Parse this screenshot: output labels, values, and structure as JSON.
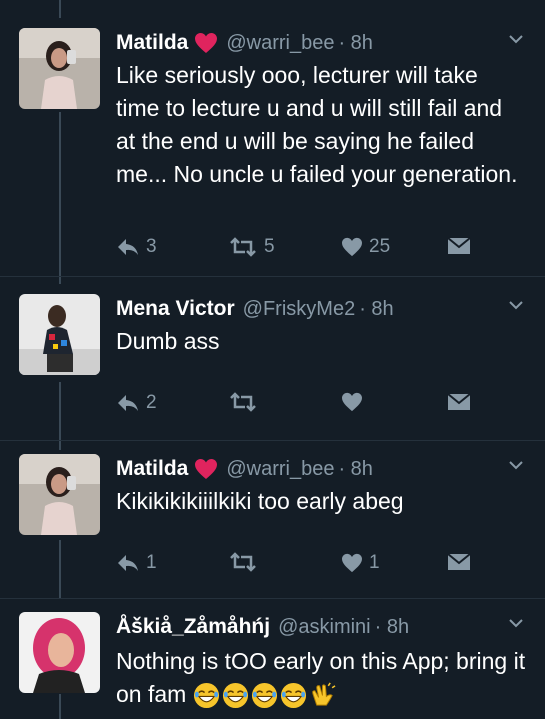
{
  "colors": {
    "background": "#141d26",
    "text": "#ffffff",
    "muted": "#8899a6",
    "icon": "#8899a6",
    "heart_badge": "#e0245e"
  },
  "tweets": [
    {
      "name": "Matilda",
      "handle": "@warri_bee",
      "time": "· 8h",
      "has_heart_badge": true,
      "text": "Like seriously ooo,  lecturer will take time to lecture u and u will still fail and at the end u will be saying he failed me... No uncle u failed your generation.",
      "replies": "3",
      "retweets": "5",
      "likes": "25"
    },
    {
      "name": "Mena Victor",
      "handle": "@FriskyMe2",
      "time": "· 8h",
      "has_heart_badge": false,
      "text": "Dumb ass",
      "replies": "2",
      "retweets": "",
      "likes": ""
    },
    {
      "name": "Matilda",
      "handle": "@warri_bee",
      "time": "· 8h",
      "has_heart_badge": true,
      "text": "Kikikikikiiilkiki too early abeg",
      "replies": "1",
      "retweets": "",
      "likes": "1"
    },
    {
      "name": "Åškiå_Zåmåhńj",
      "handle": "@askimini",
      "time": "· 8h",
      "has_heart_badge": false,
      "text": "Nothing is tOO early on this App; bring it on fam",
      "emojis": [
        "laughing-face",
        "laughing-face",
        "laughing-face",
        "laughing-face",
        "clapping-hands"
      ]
    }
  ]
}
